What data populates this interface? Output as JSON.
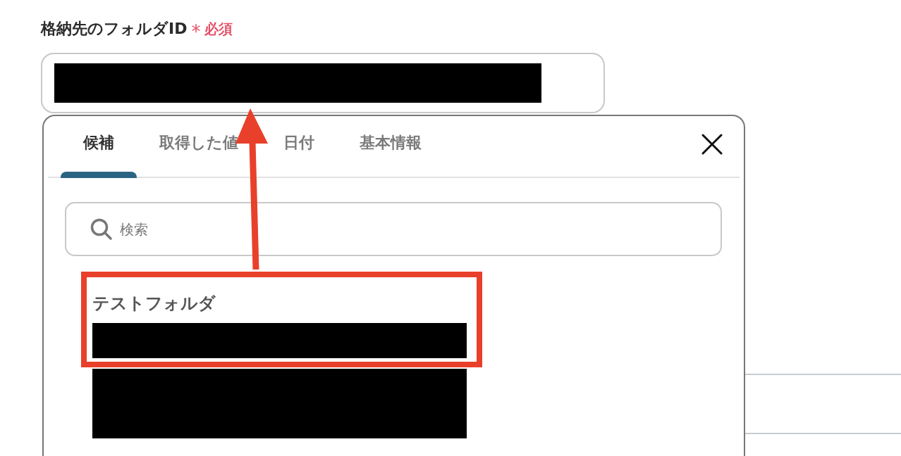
{
  "field": {
    "label": "格納先のフォルダID",
    "required_mark": "*",
    "required_text": "必須"
  },
  "popup": {
    "tabs": [
      {
        "label": "候補",
        "selected": true
      },
      {
        "label": "取得した値",
        "selected": false
      },
      {
        "label": "日付",
        "selected": false
      },
      {
        "label": "基本情報",
        "selected": false
      }
    ],
    "search": {
      "placeholder": "検索"
    },
    "options": [
      {
        "label": "テストフォルダ",
        "highlighted": true
      }
    ]
  }
}
